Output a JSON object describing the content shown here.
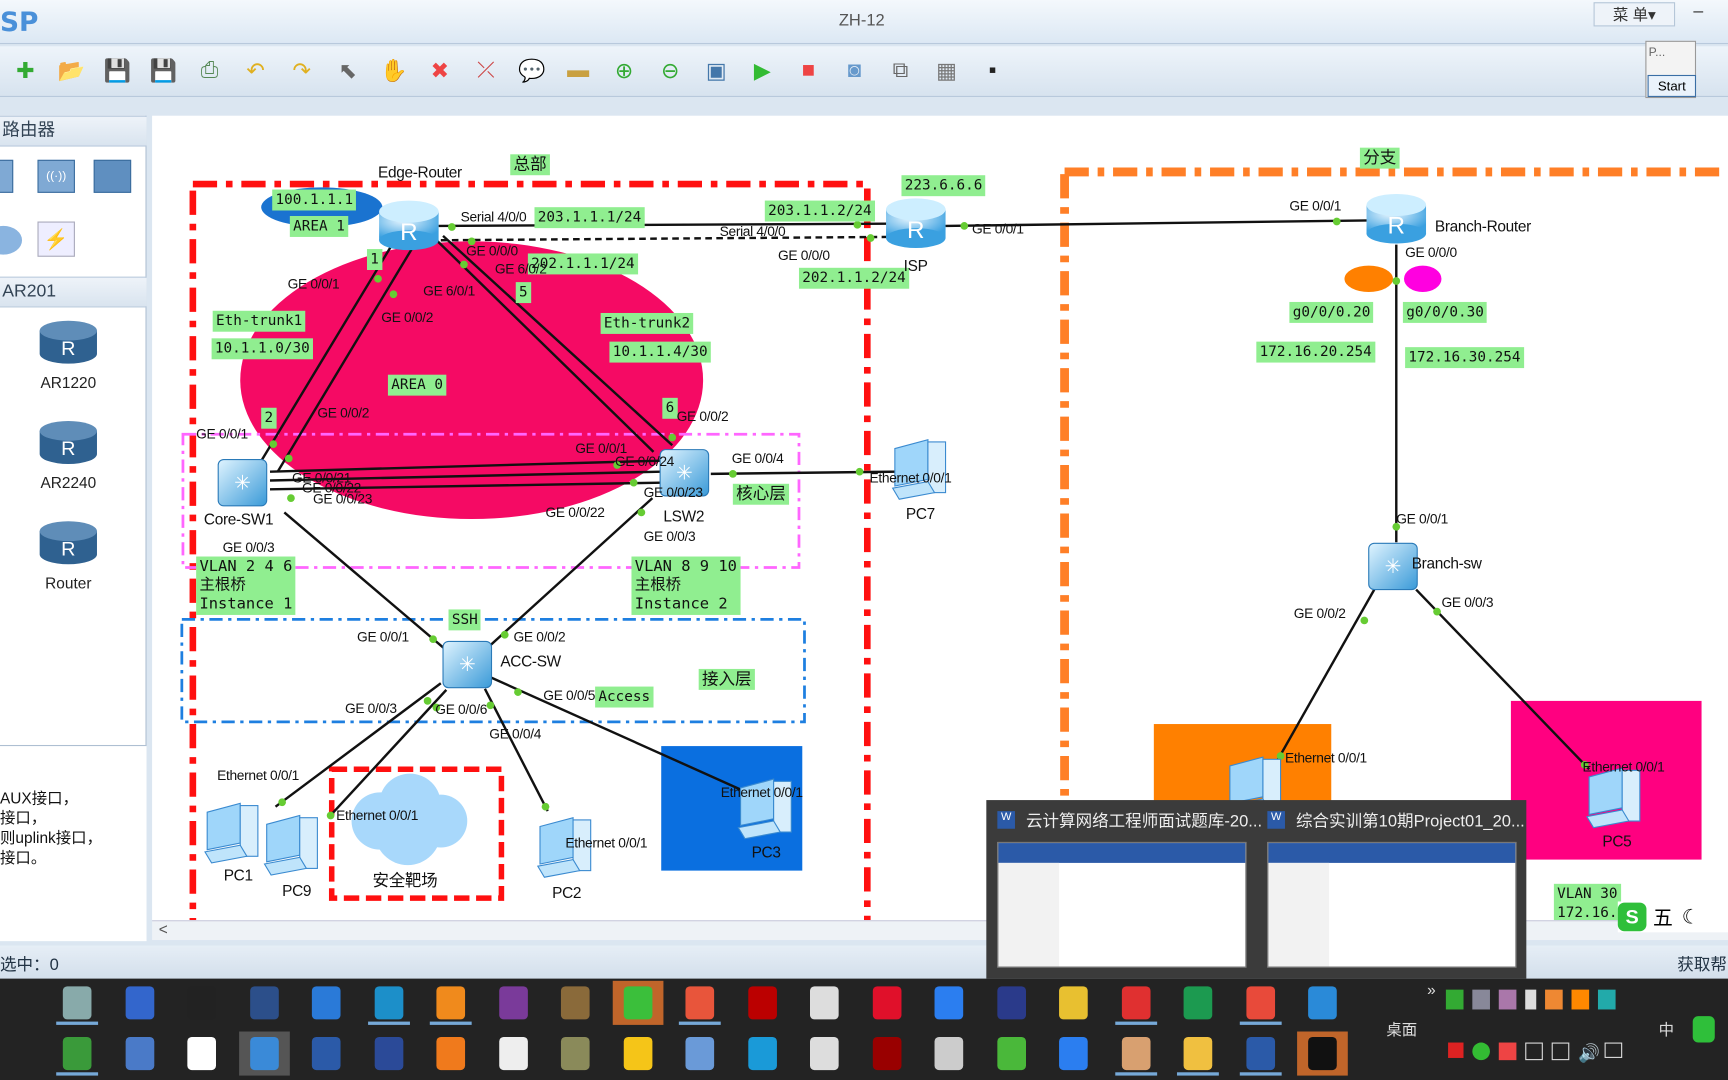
{
  "window": {
    "logo": "SP",
    "title": "ZH-12",
    "menu_label": "菜 单▾",
    "minimize_label": "–"
  },
  "toolbar": {
    "icons": [
      "new-topology-icon",
      "open-icon",
      "save-icon",
      "save-as-icon",
      "print-icon",
      "undo-icon",
      "redo-icon",
      "select-icon",
      "pan-hand-icon",
      "delete-icon",
      "delete-link-icon",
      "add-text-icon",
      "add-shape-icon",
      "zoom-in-icon",
      "zoom-out-icon",
      "fit-view-icon",
      "start-device-icon",
      "stop-device-icon",
      "capture-icon",
      "topology-icon",
      "grid-icon",
      "console-icon"
    ]
  },
  "floating_window": {
    "title": "P...",
    "start_label": "Start"
  },
  "sidebar": {
    "category_header": "路由器",
    "sub_header": "AR201",
    "devices": [
      {
        "label": "AR1220"
      },
      {
        "label": "AR2240"
      },
      {
        "label": "Router"
      }
    ],
    "info_lines": [
      "AUX接口，",
      "接口，",
      "则uplink接口，",
      "接口。"
    ]
  },
  "status": {
    "selected": "选中：0",
    "help": "获取帮"
  },
  "canvas": {
    "green_labels": [
      "总部",
      "100.1.1.1",
      "AREA 1",
      "203.1.1.1/24",
      "202.1.1.1/24",
      "1",
      "5",
      "Eth-trunk1",
      "10.1.1.0/30",
      "AREA 0",
      "Eth-trunk2",
      "10.1.1.4/30",
      "2",
      "6",
      "223.6.6.6",
      "203.1.1.2/24",
      "202.1.1.2/24",
      "分支",
      "g0/0/0.20",
      "g0/0/0.30",
      "172.16.20.254",
      "172.16.30.254",
      "核心层",
      "VLAN 2 4 6\n主根桥\nInstance 1",
      "VLAN 8 9 10\n主根桥\nInstance 2",
      "SSH",
      "Access",
      "接入层",
      "VLAN 30\n172.16."
    ],
    "labels": [
      "Edge-Router",
      "Serial 4/0/0",
      "GE 0/0/0",
      "GE 6/0/2",
      "GE 6/0/1",
      "GE 0/0/1",
      "GE 0/0/2",
      "Serial 4/0/0",
      "GE 0/0/0",
      "ISP",
      "GE 0/0/1",
      "GE 0/0/1",
      "Branch-Router",
      "GE 0/0/0",
      "GE 0/0/1",
      "GE 0/0/2",
      "GE 0/0/21",
      "GE 0/0/22",
      "GE 0/0/23",
      "Core-SW1",
      "GE 0/0/2",
      "GE 0/0/1",
      "GE 0/0/24",
      "GE 0/0/4",
      "GE 0/0/23",
      "LSW2",
      "GE 0/0/22",
      "GE 0/0/3",
      "GE 0/0/3",
      "Ethernet 0/0/1",
      "PC7",
      "GE 0/0/1",
      "GE 0/0/2",
      "ACC-SW",
      "GE 0/0/3",
      "GE 0/0/6",
      "GE 0/0/5",
      "GE 0/0/4",
      "Ethernet 0/0/1",
      "Ethernet 0/0/1",
      "Ethernet 0/0/1",
      "Ethernet 0/0/1",
      "PC1",
      "PC9",
      "安全靶场",
      "PC2",
      "PC3",
      "GE 0/0/1",
      "Branch-sw",
      "GE 0/0/2",
      "GE 0/0/3",
      "Ethernet 0/0/1",
      "Ethernet 0/0/1",
      "PC5"
    ],
    "colors": {
      "hq_zone": "#ff1010",
      "branch_zone": "#ff7f27",
      "area0": "#f50a64",
      "area1": "#1a73d0",
      "core_zone": "#ff66ff",
      "access_zone": "#1e7fe0",
      "label_bg": "#90ee90"
    }
  },
  "taskbar": {
    "row1": [
      {
        "n": "sandbox-icon",
        "c": "#8aa",
        "u": 1
      },
      {
        "n": "floppy-icon",
        "c": "#3366cc"
      },
      {
        "n": "qq-icon",
        "c": "#222"
      },
      {
        "n": "hdx-icon",
        "c": "#2c4f8a"
      },
      {
        "n": "shark-icon",
        "c": "#2a7ad8"
      },
      {
        "n": "net-icon",
        "c": "#1c8fc9",
        "u": 1
      },
      {
        "n": "search-tool-icon",
        "c": "#f08a1c",
        "u": 1
      },
      {
        "n": "onenote-icon",
        "c": "#7a3a9a"
      },
      {
        "n": "books-icon",
        "c": "#8a6a3a"
      },
      {
        "n": "wechat-icon",
        "c": "#3bbf3b",
        "a": 1
      },
      {
        "n": "c-app-icon",
        "c": "#e8553b",
        "u": 1
      },
      {
        "n": "filezilla-icon",
        "c": "#b00"
      },
      {
        "n": "python-icon",
        "c": "#ddd"
      },
      {
        "n": "youdao-icon",
        "c": "#e0102a"
      },
      {
        "n": "blue-pen-icon",
        "c": "#2b7ef0"
      },
      {
        "n": "eclipse-icon",
        "c": "#2a3a8a"
      },
      {
        "n": "chrome-icon",
        "c": "#e8c030"
      },
      {
        "n": "swirl-icon",
        "c": "#e03030",
        "u": 1
      },
      {
        "n": "pycharm-icon",
        "c": "#1c9a50"
      },
      {
        "n": "wps-icon",
        "c": "#e84a3a",
        "u": 1
      },
      {
        "n": "find-icon",
        "c": "#2a8ad8"
      }
    ],
    "row2": [
      {
        "n": "notepad-icon",
        "c": "#3a9a3a",
        "u": 1
      },
      {
        "n": "network-monitor-icon",
        "c": "#4a7ac8"
      },
      {
        "n": "baidu-netdisk-icon",
        "c": "#fff"
      },
      {
        "n": "ensp-icon",
        "c": "#3a8ad8",
        "a": 2
      },
      {
        "n": "word-m-icon",
        "c": "#2b5aa8"
      },
      {
        "n": "visio-icon",
        "c": "#2b4a98"
      },
      {
        "n": "firefox-icon",
        "c": "#f07a1c"
      },
      {
        "n": "typora-icon",
        "c": "#eee"
      },
      {
        "n": "tool-icon",
        "c": "#8a8a5a"
      },
      {
        "n": "sticky-icon",
        "c": "#f5c518"
      },
      {
        "n": "viewer-icon",
        "c": "#6a9ad8"
      },
      {
        "n": "edge-icon",
        "c": "#1a9ad8"
      },
      {
        "n": "tcpip-icon",
        "c": "#ddd"
      },
      {
        "n": "red-app-icon",
        "c": "#900"
      },
      {
        "n": "lock-icon",
        "c": "#ccc"
      },
      {
        "n": "camtasia-icon",
        "c": "#4ab83a"
      },
      {
        "n": "bird-icon",
        "c": "#2b7ef0"
      },
      {
        "n": "paint-icon",
        "c": "#d8a070",
        "u": 1
      },
      {
        "n": "folder-icon",
        "c": "#f0c040",
        "u": 1
      },
      {
        "n": "word-icon",
        "c": "#2b5aa8",
        "u": 1
      },
      {
        "n": "recorder-icon",
        "c": "#111",
        "a": 1
      }
    ],
    "desktop_label": "桌面",
    "ime_label": "中"
  },
  "preview": {
    "windows": [
      {
        "title": "云计算网络工程师面试题库-20..."
      },
      {
        "title": "综合实训第10期Project01_20..."
      }
    ]
  },
  "ime_bar": {
    "mode": "五"
  }
}
